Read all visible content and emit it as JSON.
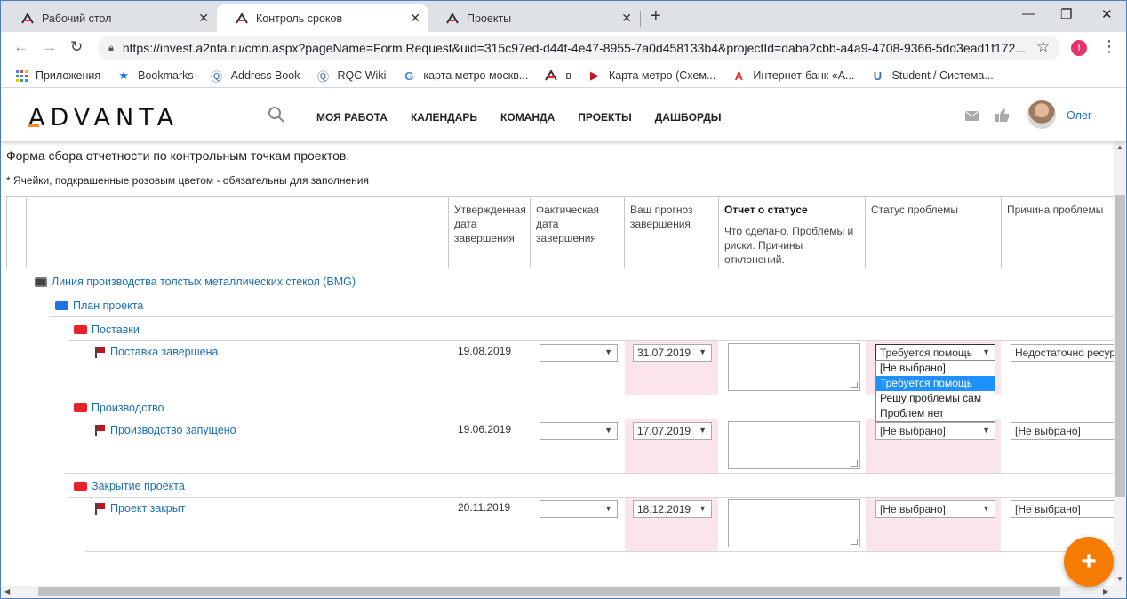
{
  "browser": {
    "tabs": [
      {
        "title": "Рабочий стол"
      },
      {
        "title": "Контроль сроков"
      },
      {
        "title": "Проекты"
      }
    ],
    "url": "https://invest.a2nta.ru/cmn.aspx?pageName=Form.Request&uid=315c97ed-d44f-4e47-8955-7a0d458133b4&projectId=daba2cbb-a4a9-4708-9366-5dd3ead1f172...",
    "profile_initial": "I",
    "bookmarks": [
      "Приложения",
      "Bookmarks",
      "Address Book",
      "RQC Wiki",
      "карта метро москв...",
      "в",
      "Карта метро (Схем...",
      "Интернет-банк «А...",
      "Student / Система..."
    ]
  },
  "app": {
    "logo": "ADVANTA",
    "nav": [
      "МОЯ РАБОТА",
      "КАЛЕНДАРЬ",
      "КОМАНДА",
      "ПРОЕКТЫ",
      "ДАШБОРДЫ"
    ],
    "user": "Олег",
    "accent": "#f57c00",
    "link_color": "#1a6fb5"
  },
  "form": {
    "title": "Форма сбора отчетности по контрольным точкам проектов.",
    "note": "* Ячейки, подкрашенные розовым цветом - обязательны для заполнения",
    "columns": {
      "approved": "Утвержденная дата завершения",
      "actual": "Фактическая дата завершения",
      "forecast": "Ваш прогноз завершения",
      "report_title": "Отчет о статусе",
      "report_sub": "Что сделано. Проблемы и риски. Причины отклонений.",
      "status": "Статус проблемы",
      "reason": "Причина проблемы"
    },
    "project": "Линия производства толстых металлических стекол (BMG)",
    "plan": "План проекта",
    "groups": [
      {
        "name": "Поставки",
        "milestone": "Поставка завершена",
        "approved": "19.08.2019",
        "forecast": "31.07.2019",
        "status": "Требуется помощь",
        "reason": "Недостаточно ресурсов"
      },
      {
        "name": "Производство",
        "milestone": "Производство запущено",
        "approved": "19.06.2019",
        "forecast": "17.07.2019",
        "status": "[Не выбрано]",
        "reason": "[Не выбрано]"
      },
      {
        "name": "Закрытие проекта",
        "milestone": "Проект закрыт",
        "approved": "20.11.2019",
        "forecast": "18.12.2019",
        "status": "[Не выбрано]",
        "reason": "[Не выбрано]"
      }
    ],
    "status_options": [
      "[Не выбрано]",
      "Требуется помощь",
      "Решу проблемы сам",
      "Проблем нет"
    ],
    "highlighted_option": 1
  },
  "fab_label": "+"
}
